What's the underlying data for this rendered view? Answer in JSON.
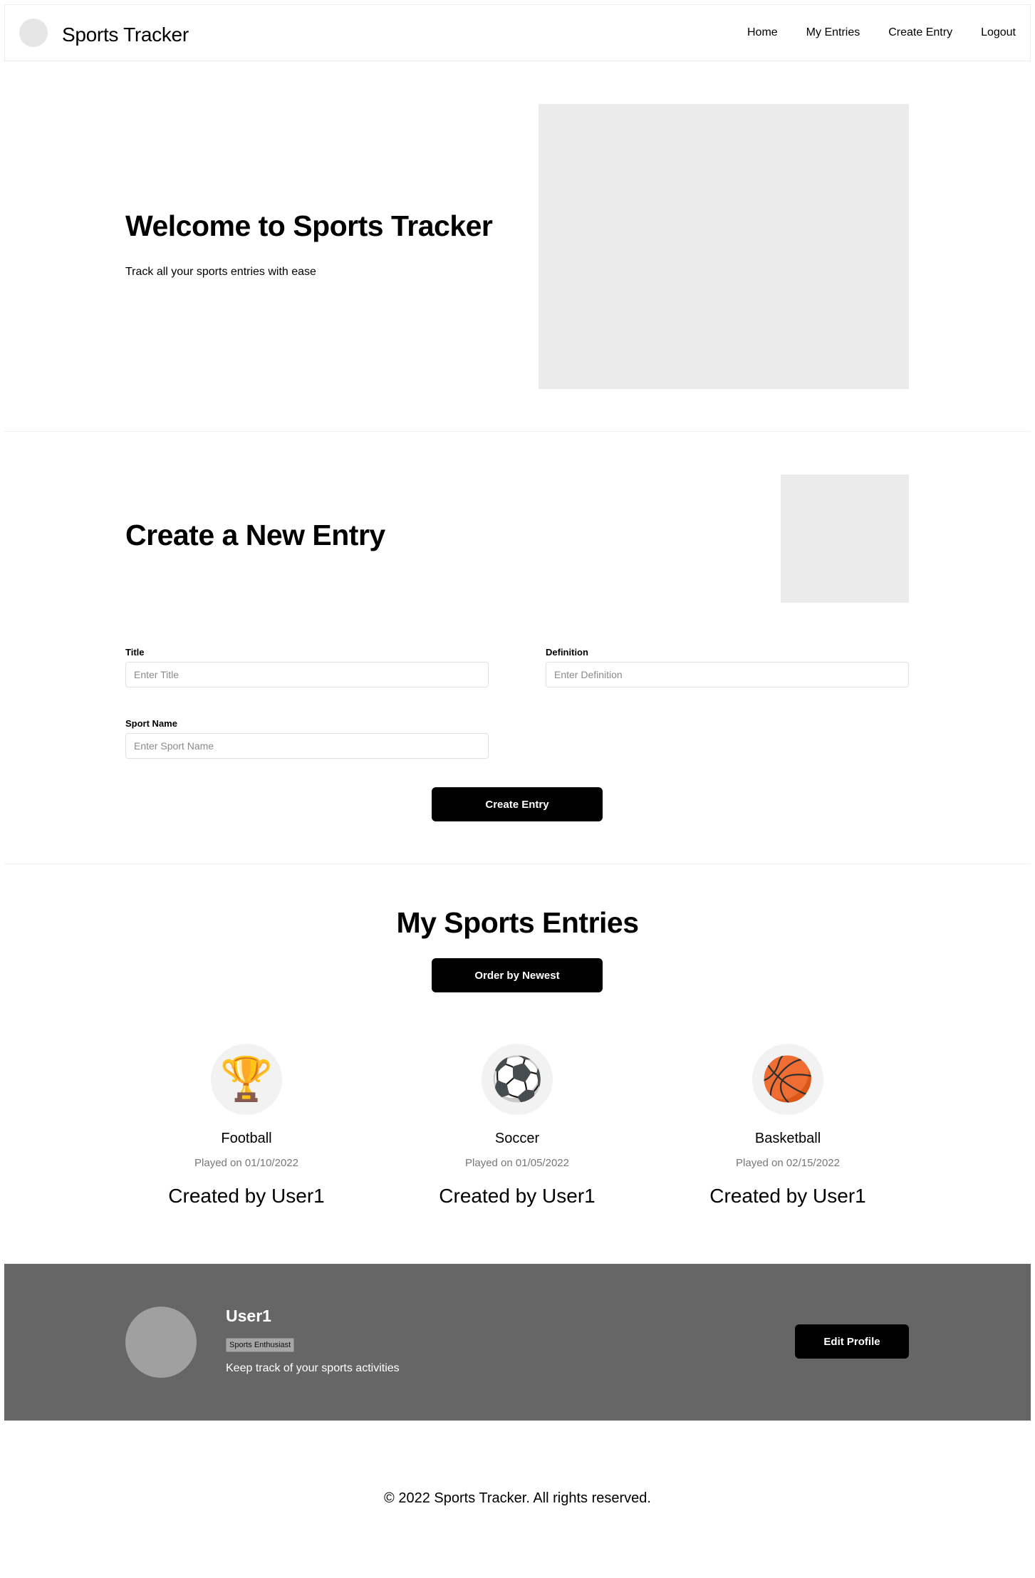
{
  "nav": {
    "brand": "Sports Tracker",
    "links": [
      "Home",
      "My Entries",
      "Create Entry",
      "Logout"
    ]
  },
  "hero": {
    "title": "Welcome to Sports Tracker",
    "subtitle": "Track all your sports entries with ease"
  },
  "create": {
    "title": "Create a New Entry",
    "fields": {
      "title": {
        "label": "Title",
        "placeholder": "Enter Title",
        "value": ""
      },
      "definition": {
        "label": "Definition",
        "placeholder": "Enter Definition",
        "value": ""
      },
      "sport_name": {
        "label": "Sport Name",
        "placeholder": "Enter Sport Name",
        "value": ""
      }
    },
    "submit_label": "Create Entry"
  },
  "entries": {
    "title": "My Sports Entries",
    "order_label": "Order by Newest",
    "items": [
      {
        "icon": "trophy-icon",
        "glyph": "🏆",
        "name": "Football",
        "date": "Played on 01/10/2022",
        "created_by": "Created by User1"
      },
      {
        "icon": "soccer-ball-icon",
        "glyph": "⚽",
        "name": "Soccer",
        "date": "Played on 01/05/2022",
        "created_by": "Created by User1"
      },
      {
        "icon": "basketball-icon",
        "glyph": "🏀",
        "name": "Basketball",
        "date": "Played on 02/15/2022",
        "created_by": "Created by User1"
      }
    ]
  },
  "profile": {
    "username": "User1",
    "badge": "Sports Enthusiast",
    "description": "Keep track of your sports activities",
    "edit_label": "Edit Profile"
  },
  "footer": {
    "text": "© 2022 Sports Tracker. All rights reserved."
  },
  "colors": {
    "accent": "#000000",
    "placeholder_bg": "#ebebeb",
    "profile_bg": "#666666"
  }
}
